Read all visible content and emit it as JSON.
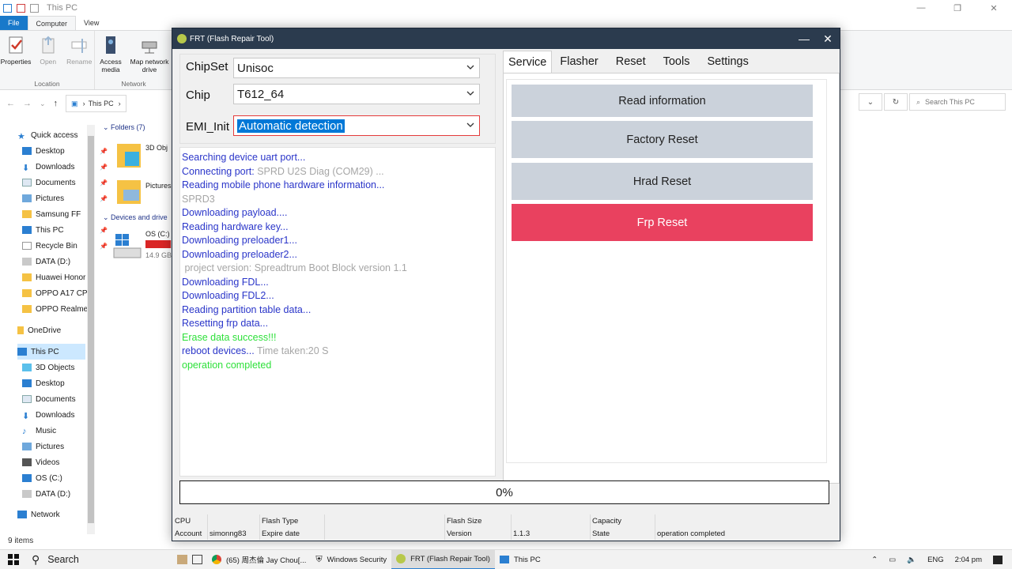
{
  "explorer": {
    "title": "This PC",
    "tabs": [
      "File",
      "Computer",
      "View"
    ],
    "ribbon": {
      "location": {
        "name": "Location",
        "buttons": [
          "Properties",
          "Open",
          "Rename"
        ]
      },
      "network": {
        "name": "Network",
        "buttons": [
          "Access media",
          "Map network drive"
        ]
      }
    },
    "address": "This PC",
    "search_placeholder": "Search This PC",
    "nav": {
      "quick_access": "Quick access",
      "items": [
        "Desktop",
        "Downloads",
        "Documents",
        "Pictures",
        "Samsung FF",
        "This PC",
        "Recycle Bin",
        "DATA (D:)",
        "Huawei Honor",
        "OPPO A17 CPH",
        "OPPO Realme"
      ],
      "onedrive": "OneDrive",
      "this_pc": "This PC",
      "this_pc_items": [
        "3D Objects",
        "Desktop",
        "Documents",
        "Downloads",
        "Music",
        "Pictures",
        "Videos",
        "OS (C:)",
        "DATA (D:)"
      ],
      "network": "Network"
    },
    "content": {
      "folders_header": "Folders (7)",
      "folders": [
        "3D Obj",
        "Pictures"
      ],
      "devices_header": "Devices and drive",
      "drive_name": "OS (C:)",
      "drive_space": "14.9 GB",
      "drive_used_fraction": 0.9
    },
    "status": "9 items"
  },
  "frt": {
    "title": "FRT (Flash Repair Tool)",
    "chipset": {
      "label": "ChipSet",
      "value": "Unisoc"
    },
    "chip": {
      "label": "Chip",
      "value": "T612_64"
    },
    "emi": {
      "label": "EMI_Init",
      "value": "Automatic detection"
    },
    "log": [
      {
        "text": "Searching device uart port...",
        "color": "blue"
      },
      {
        "text": "Connecting port: ",
        "color": "blue",
        "extra": "SPRD U2S Diag (COM29) ..."
      },
      {
        "text": "Reading mobile phone hardware information...",
        "color": "blue"
      },
      {
        "text": "SPRD3",
        "color": "gray"
      },
      {
        "text": "Downloading payload....",
        "color": "blue"
      },
      {
        "text": "Reading hardware key...",
        "color": "blue"
      },
      {
        "text": "Downloading preloader1...",
        "color": "blue"
      },
      {
        "text": "Downloading preloader2...",
        "color": "blue"
      },
      {
        "text": " project version: Spreadtrum Boot Block version 1.1",
        "color": "gray"
      },
      {
        "text": "Downloading FDL...",
        "color": "blue"
      },
      {
        "text": "Downloading FDL2...",
        "color": "blue"
      },
      {
        "text": "Reading partition table data...",
        "color": "blue"
      },
      {
        "text": "Resetting frp data...",
        "color": "blue"
      },
      {
        "text": "Erase data success!!!",
        "color": "green"
      },
      {
        "text": "reboot devices... ",
        "color": "blue",
        "extra": "Time taken:20 S"
      },
      {
        "text": "operation completed",
        "color": "green"
      }
    ],
    "tabs": [
      "Service",
      "Flasher",
      "Reset",
      "Tools",
      "Settings"
    ],
    "active_tab": "Service",
    "actions": [
      "Read information",
      "Factory Reset",
      "Hrad Reset",
      "Frp Reset"
    ],
    "progress": "0%",
    "info": {
      "cpu_label": "CPU",
      "cpu_value": "",
      "flash_type_label": "Flash Type",
      "flash_type_value": "",
      "flash_size_label": "Flash Size",
      "flash_size_value": "",
      "capacity_label": "Capacity",
      "capacity_value": "",
      "account_label": "Account",
      "account_value": "simonng83",
      "expire_label": "Expire date",
      "expire_value": "",
      "version_label": "Version",
      "version_value": "1.1.3",
      "state_label": "State",
      "state_value": "operation completed"
    },
    "colors": {
      "title_bar": "#2b3b4e",
      "frp_button": "#e9415f",
      "action_button": "#cbd2db",
      "log_blue": "#2a35c9",
      "log_green": "#2ee03a",
      "log_gray": "#a6a6a6"
    }
  },
  "taskbar": {
    "search": "Search",
    "apps": [
      "(65) 周杰倫 Jay Chou[...",
      "Windows Security",
      "FRT (Flash Repair Tool)",
      "This PC"
    ],
    "lang": "ENG",
    "time": "2:04 pm"
  }
}
